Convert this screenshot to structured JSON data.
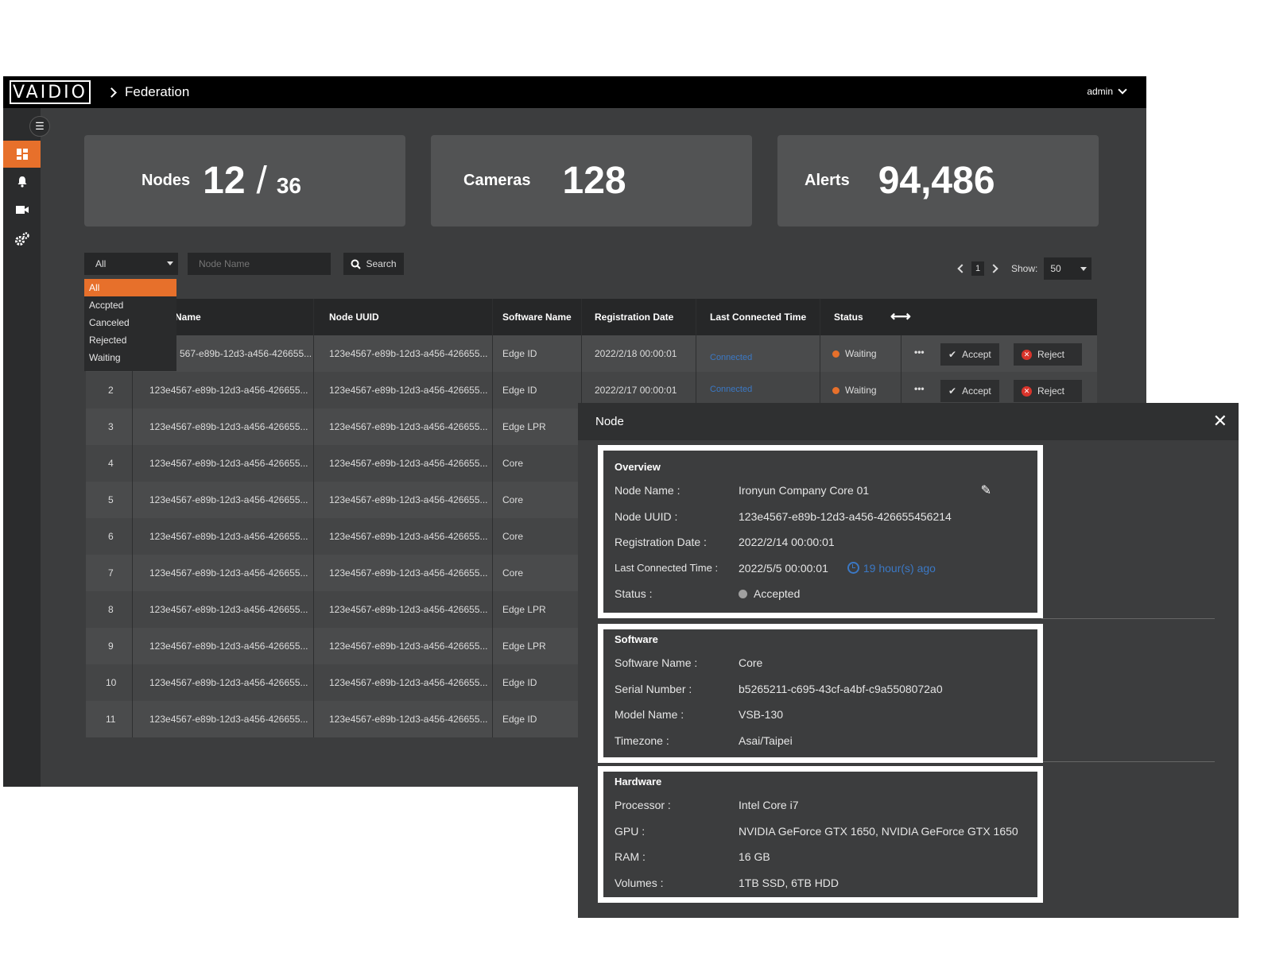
{
  "header": {
    "logo": "VAIDIO",
    "breadcrumb": "Federation",
    "user": "admin"
  },
  "sidebar": {
    "menu_icon": "hamburger-icon",
    "items": [
      {
        "icon": "dashboard-icon",
        "active": true
      },
      {
        "icon": "bell-icon",
        "active": false
      },
      {
        "icon": "camera-icon",
        "active": false
      },
      {
        "icon": "gears-icon",
        "active": false
      }
    ]
  },
  "stats": {
    "nodes_label": "Nodes",
    "nodes_value": "12",
    "nodes_sep": "/",
    "nodes_total": "36",
    "cameras_label": "Cameras",
    "cameras_value": "128",
    "alerts_label": "Alerts",
    "alerts_value": "94,486"
  },
  "filters": {
    "status_selected": "All",
    "status_options": [
      "All",
      "Accpted",
      "Canceled",
      "Rejected",
      "Waiting"
    ],
    "name_placeholder": "Node Name",
    "search_label": "Search"
  },
  "pagination": {
    "page": "1",
    "show_label": "Show:",
    "show_value": "50"
  },
  "table": {
    "headers": [
      "Name",
      "Node UUID",
      "Software Name",
      "Registration Date",
      "Last Connected Time",
      "Status"
    ],
    "rows": [
      {
        "num": "",
        "name": "567-e89b-12d3-a456-426655...",
        "uuid": "123e4567-e89b-12d3-a456-426655...",
        "software": "Edge ID",
        "reg": "2022/2/18 00:00:01",
        "conn": "Connected",
        "status": "Waiting"
      },
      {
        "num": "2",
        "name": "123e4567-e89b-12d3-a456-426655...",
        "uuid": "123e4567-e89b-12d3-a456-426655...",
        "software": "Edge ID",
        "reg": "2022/2/17 00:00:01",
        "conn": "Connected",
        "status": "Waiting"
      },
      {
        "num": "3",
        "name": "123e4567-e89b-12d3-a456-426655...",
        "uuid": "123e4567-e89b-12d3-a456-426655...",
        "software": "Edge LPR"
      },
      {
        "num": "4",
        "name": "123e4567-e89b-12d3-a456-426655...",
        "uuid": "123e4567-e89b-12d3-a456-426655...",
        "software": "Core"
      },
      {
        "num": "5",
        "name": "123e4567-e89b-12d3-a456-426655...",
        "uuid": "123e4567-e89b-12d3-a456-426655...",
        "software": "Core"
      },
      {
        "num": "6",
        "name": "123e4567-e89b-12d3-a456-426655...",
        "uuid": "123e4567-e89b-12d3-a456-426655...",
        "software": "Core"
      },
      {
        "num": "7",
        "name": "123e4567-e89b-12d3-a456-426655...",
        "uuid": "123e4567-e89b-12d3-a456-426655...",
        "software": "Core"
      },
      {
        "num": "8",
        "name": "123e4567-e89b-12d3-a456-426655...",
        "uuid": "123e4567-e89b-12d3-a456-426655...",
        "software": "Edge LPR"
      },
      {
        "num": "9",
        "name": "123e4567-e89b-12d3-a456-426655...",
        "uuid": "123e4567-e89b-12d3-a456-426655...",
        "software": "Edge LPR"
      },
      {
        "num": "10",
        "name": "123e4567-e89b-12d3-a456-426655...",
        "uuid": "123e4567-e89b-12d3-a456-426655...",
        "software": "Edge ID"
      },
      {
        "num": "11",
        "name": "123e4567-e89b-12d3-a456-426655...",
        "uuid": "123e4567-e89b-12d3-a456-426655...",
        "software": "Edge ID"
      }
    ],
    "more_label": "•••",
    "accept_label": "Accept",
    "reject_label": "Reject"
  },
  "dialog": {
    "title": "Node",
    "overview": {
      "title": "Overview",
      "node_name_label": "Node Name :",
      "node_name": "Ironyun Company Core 01",
      "uuid_label": "Node UUID :",
      "uuid": "123e4567-e89b-12d3-a456-426655456214",
      "reg_label": "Registration Date :",
      "reg": "2022/2/14 00:00:01",
      "conn_label": "Last Connected Time :",
      "conn": "2022/5/5 00:00:01",
      "ago": "19 hour(s) ago",
      "status_label": "Status :",
      "status": "Accepted"
    },
    "software": {
      "title": "Software",
      "name_label": "Software Name :",
      "name": "Core",
      "serial_label": "Serial Number :",
      "serial": "b5265211-c695-43cf-a4bf-c9a5508072a0",
      "model_label": "Model Name :",
      "model": "VSB-130",
      "tz_label": "Timezone :",
      "tz": "Asai/Taipei"
    },
    "hardware": {
      "title": "Hardware",
      "cpu_label": "Processor :",
      "cpu": "Intel Core i7",
      "gpu_label": "GPU :",
      "gpu": "NVIDIA GeForce GTX 1650, NVIDIA GeForce GTX 1650",
      "ram_label": "RAM :",
      "ram": "16 GB",
      "vol_label": "Volumes :",
      "vol": "1TB SSD, 6TB HDD"
    }
  },
  "colors": {
    "accent": "#e7702b",
    "link": "#3b78c4",
    "reject": "#d9342b",
    "panel_bg": "#3c3d3e"
  }
}
